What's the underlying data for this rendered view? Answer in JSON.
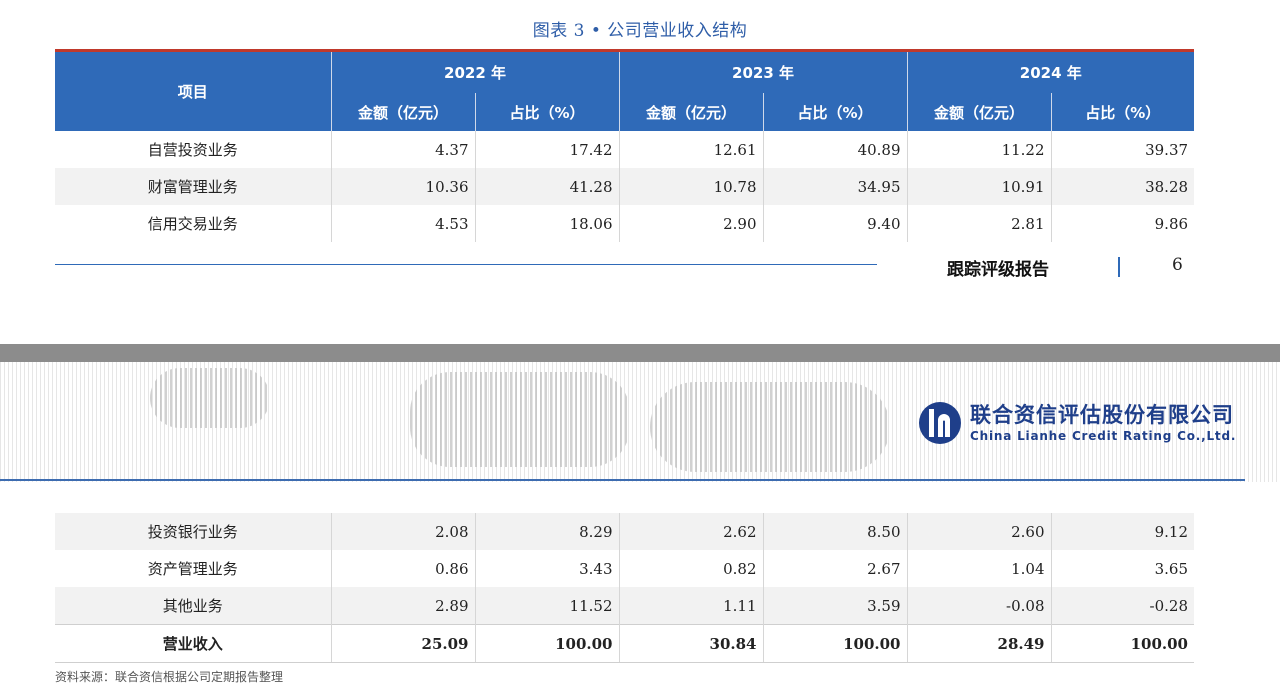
{
  "caption": "图表 3 •  公司营业收入结构",
  "table": {
    "item_header": "项目",
    "years": [
      "2022 年",
      "2023 年",
      "2024 年"
    ],
    "sub_headers": [
      "金额（亿元）",
      "占比（%）"
    ],
    "rows_top": [
      {
        "name": "自营投资业务",
        "values": [
          "4.37",
          "17.42",
          "12.61",
          "40.89",
          "11.22",
          "39.37"
        ]
      },
      {
        "name": "财富管理业务",
        "values": [
          "10.36",
          "41.28",
          "10.78",
          "34.95",
          "10.91",
          "38.28"
        ]
      },
      {
        "name": "信用交易业务",
        "values": [
          "4.53",
          "18.06",
          "2.90",
          "9.40",
          "2.81",
          "9.86"
        ]
      }
    ],
    "rows_bottom": [
      {
        "name": "投资银行业务",
        "values": [
          "2.08",
          "8.29",
          "2.62",
          "8.50",
          "2.60",
          "9.12"
        ]
      },
      {
        "name": "资产管理业务",
        "values": [
          "0.86",
          "3.43",
          "0.82",
          "2.67",
          "1.04",
          "3.65"
        ]
      },
      {
        "name": "其他业务",
        "values": [
          "2.89",
          "11.52",
          "1.11",
          "3.59",
          "-0.08",
          "-0.28"
        ]
      }
    ],
    "total": {
      "name": "营业收入",
      "values": [
        "25.09",
        "100.00",
        "30.84",
        "100.00",
        "28.49",
        "100.00"
      ]
    }
  },
  "footer": {
    "report_label": "跟踪评级报告",
    "page_number": "6"
  },
  "logo": {
    "name_cn": "联合资信评估股份有限公司",
    "name_en": "China Lianhe Credit Rating Co.,Ltd."
  },
  "source": "资料来源：联合资信根据公司定期报告整理",
  "colors": {
    "header_blue": "#2f6ab8",
    "accent_red": "#c0392b",
    "logo_blue": "#1f3f8a"
  }
}
